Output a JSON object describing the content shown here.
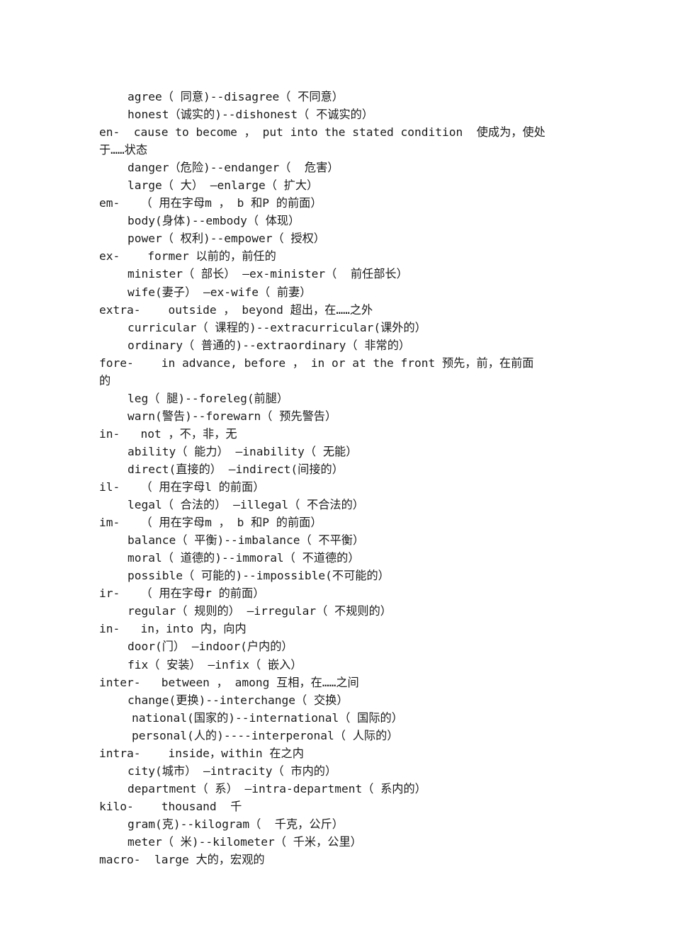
{
  "document": {
    "title": "English Prefixes Word List",
    "page_background": "#ffffff",
    "text_color": "#1a1a1a",
    "lines": [
      {
        "id": "l01",
        "kind": "ex",
        "text": "agree（ 同意)--disagree（ 不同意）"
      },
      {
        "id": "l02",
        "kind": "ex",
        "text": "honest（诚实的)--dishonest（ 不诚实的）"
      },
      {
        "id": "l03",
        "kind": "head",
        "text": "en-  cause to become ， put into the stated condition  使成为，使处"
      },
      {
        "id": "l04",
        "kind": "cont",
        "text": "于……状态"
      },
      {
        "id": "l05",
        "kind": "ex",
        "text": "danger（危险)--endanger（  危害）"
      },
      {
        "id": "l06",
        "kind": "ex",
        "text": "large（ 大） —enlarge（ 扩大）"
      },
      {
        "id": "l07",
        "kind": "head",
        "text": "em-   （ 用在字母m ， b 和P 的前面）"
      },
      {
        "id": "l08",
        "kind": "ex",
        "text": "body(身体)--embody（ 体现）"
      },
      {
        "id": "l09",
        "kind": "ex",
        "text": "power（ 权利)--empower（ 授权）"
      },
      {
        "id": "l10",
        "kind": "head",
        "text": "ex-    former 以前的，前任的"
      },
      {
        "id": "l11",
        "kind": "ex",
        "text": "minister（ 部长） —ex-minister（  前任部长）"
      },
      {
        "id": "l12",
        "kind": "ex",
        "text": "wife(妻子） —ex-wife（ 前妻）"
      },
      {
        "id": "l13",
        "kind": "head",
        "text": "extra-    outside ， beyond 超出，在……之外"
      },
      {
        "id": "l14",
        "kind": "ex",
        "text": "curricular（ 课程的)--extracurricular(课外的）"
      },
      {
        "id": "l15",
        "kind": "ex",
        "text": "ordinary（ 普通的)--extraordinary（ 非常的）"
      },
      {
        "id": "l16",
        "kind": "head",
        "text": "fore-    in advance, before ， in or at the front 预先，前，在前面"
      },
      {
        "id": "l17",
        "kind": "cont",
        "text": "的"
      },
      {
        "id": "l18",
        "kind": "ex",
        "text": "leg（ 腿)--foreleg(前腿）"
      },
      {
        "id": "l19",
        "kind": "ex",
        "text": "warn(警告)--forewarn（ 预先警告）"
      },
      {
        "id": "l20",
        "kind": "head",
        "text": "in-   not ，不，非，无"
      },
      {
        "id": "l21",
        "kind": "ex",
        "text": "ability（ 能力） —inability（ 无能）"
      },
      {
        "id": "l22",
        "kind": "ex",
        "text": "direct(直接的） —indirect(间接的）"
      },
      {
        "id": "l23",
        "kind": "head",
        "text": "il-   （ 用在字母l 的前面）"
      },
      {
        "id": "l24",
        "kind": "ex",
        "text": "legal（ 合法的） —illegal（ 不合法的）"
      },
      {
        "id": "l25",
        "kind": "head",
        "text": "im-   （ 用在字母m ， b 和P 的前面）"
      },
      {
        "id": "l26",
        "kind": "ex",
        "text": "balance（ 平衡)--imbalance（ 不平衡）"
      },
      {
        "id": "l27",
        "kind": "ex",
        "text": "moral（ 道德的)--immoral（ 不道德的）"
      },
      {
        "id": "l28",
        "kind": "ex",
        "text": "possible（ 可能的)--impossible(不可能的）"
      },
      {
        "id": "l29",
        "kind": "head",
        "text": "ir-   （ 用在字母r 的前面）"
      },
      {
        "id": "l30",
        "kind": "ex",
        "text": "regular（ 规则的） —irregular（ 不规则的）"
      },
      {
        "id": "l31",
        "kind": "head",
        "text": "in-   in，into 内，向内"
      },
      {
        "id": "l32",
        "kind": "ex",
        "text": "door(门） —indoor(户内的）"
      },
      {
        "id": "l33",
        "kind": "ex",
        "text": "fix（ 安装） —infix（ 嵌入）"
      },
      {
        "id": "l34",
        "kind": "head",
        "text": "inter-   between ， among 互相，在……之间"
      },
      {
        "id": "l35",
        "kind": "ex",
        "text": "change(更换)--interchange（ 交换）"
      },
      {
        "id": "l36",
        "kind": "ex2",
        "text": "national(国家的)--international（ 国际的）"
      },
      {
        "id": "l37",
        "kind": "ex2",
        "text": "personal(人的)----interperonal（ 人际的）"
      },
      {
        "id": "l38",
        "kind": "head",
        "text": "intra-    inside，within 在之内"
      },
      {
        "id": "l39",
        "kind": "ex",
        "text": "city(城市） —intracity（ 市内的）"
      },
      {
        "id": "l40",
        "kind": "ex",
        "text": "department（ 系） —intra-department（ 系内的）"
      },
      {
        "id": "l41",
        "kind": "head",
        "text": "kilo-    thousand  千"
      },
      {
        "id": "l42",
        "kind": "ex",
        "text": "gram(克)--kilogram（  千克，公斤）"
      },
      {
        "id": "l43",
        "kind": "ex",
        "text": "meter（ 米)--kilometer（ 千米，公里）"
      },
      {
        "id": "l44",
        "kind": "head",
        "text": "macro-  large 大的，宏观的"
      }
    ]
  }
}
